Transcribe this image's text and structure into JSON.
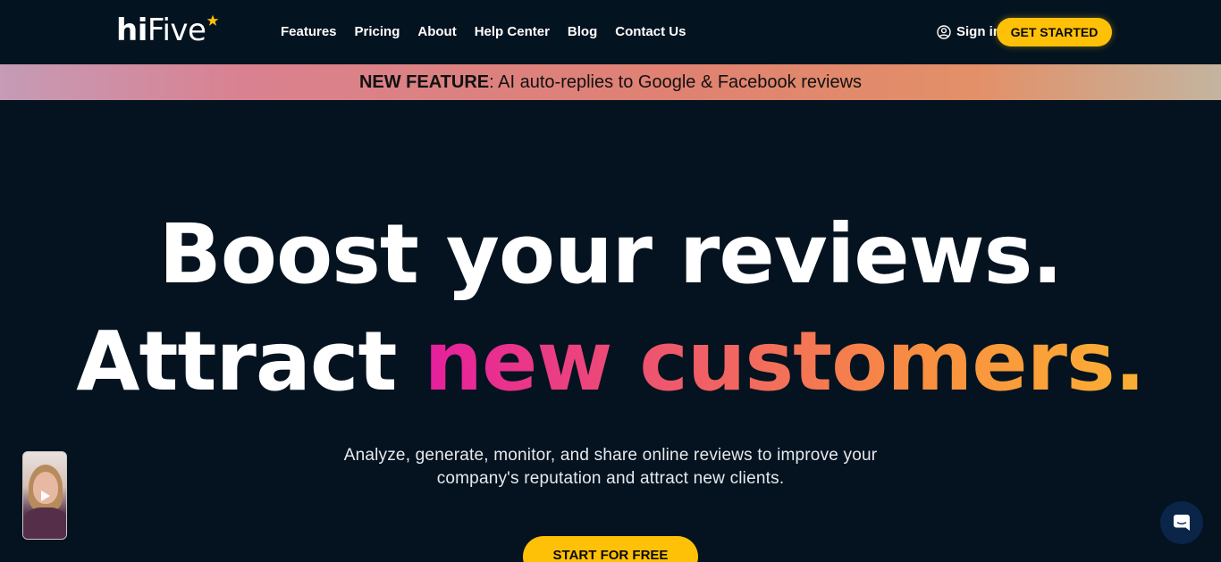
{
  "header": {
    "logo_regular": "hi",
    "logo_rest": "Five",
    "nav": [
      "Features",
      "Pricing",
      "About",
      "Help Center",
      "Blog",
      "Contact Us"
    ],
    "signin_label": "Sign in",
    "cta_label": "GET STARTED"
  },
  "banner": {
    "glyph_left": "",
    "label": "NEW FEATURE",
    "text": ": AI auto-replies to Google & Facebook reviews",
    "glyph_right": ""
  },
  "hero": {
    "line1_a": "Boost your ",
    "line1_b": "reviews",
    "line1_c": ".",
    "line2_a": "Attract ",
    "line2_b": "new customers."
  },
  "subtitle": "Analyze, generate, monitor, and share online reviews to improve  your company's reputation and attract new clients.",
  "cta_main": "START FOR FREE",
  "colors": {
    "background": "#04131f",
    "accent_yellow": "#ffc107",
    "gradient_start": "#e61e9e",
    "gradient_end": "#fbb033"
  },
  "icons": {
    "logo_star": "star-icon",
    "signin": "user-circle-icon",
    "video": "play-icon",
    "chat": "chat-icon"
  }
}
